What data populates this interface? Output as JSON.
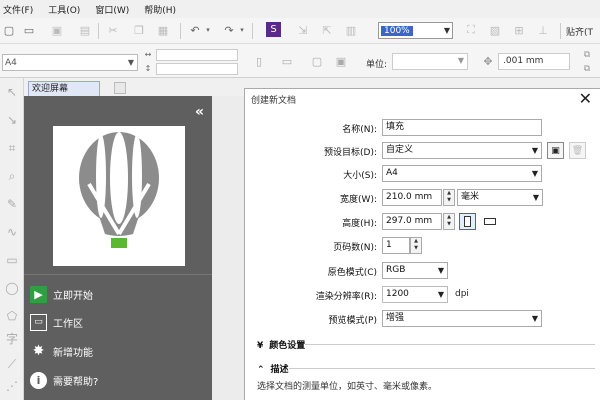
{
  "menu": {
    "file": "文件(F)",
    "tools": "工具(O)",
    "window": "窗口(W)",
    "help": "帮助(H)"
  },
  "toolbar": {
    "zoom_value": "100%",
    "snap_label": "贴齐(T"
  },
  "propbar": {
    "paper": "A4",
    "units_label": "单位:",
    "nudge_value": ".001 mm"
  },
  "tabs": {
    "welcome": "欢迎屏幕"
  },
  "welcome": {
    "collapse": "«",
    "items": [
      {
        "label": "立即开始"
      },
      {
        "label": "工作区"
      },
      {
        "label": "新增功能"
      },
      {
        "label": "需要帮助?"
      }
    ]
  },
  "dialog": {
    "title": "创建新文档",
    "name_label": "名称(N):",
    "name_value": "填充",
    "preset_label": "预设目标(D):",
    "preset_value": "自定义",
    "size_label": "大小(S):",
    "size_value": "A4",
    "width_label": "宽度(W):",
    "width_value": "210.0 mm",
    "unit_value": "毫米",
    "height_label": "高度(H):",
    "height_value": "297.0 mm",
    "pages_label": "页码数(N):",
    "pages_value": "1",
    "color_mode_label": "原色模式(C)",
    "color_mode_value": "RGB",
    "resolution_label": "渲染分辨率(R):",
    "resolution_value": "1200",
    "resolution_unit": "dpi",
    "preview_label": "预览模式(P)",
    "preview_value": "增强",
    "section_color": "颜色设置",
    "section_desc": "描述",
    "description": "选择文档的测量单位，如英寸、毫米或像素。"
  },
  "colors": {
    "accent": "#3b66c7",
    "start_icon": "#2ea043",
    "balloon": "#8c8c8c",
    "basket": "#5cb82e"
  }
}
